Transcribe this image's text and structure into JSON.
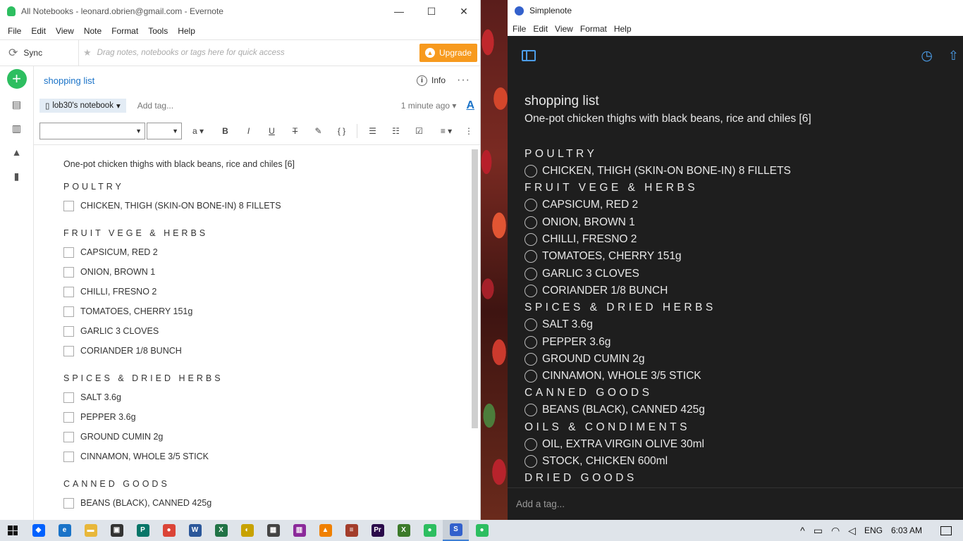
{
  "evernote": {
    "window_title": "All Notebooks - leonard.obrien@gmail.com - Evernote",
    "menu": [
      "File",
      "Edit",
      "View",
      "Note",
      "Format",
      "Tools",
      "Help"
    ],
    "sync_label": "Sync",
    "shortcut_hint": "Drag notes, notebooks or tags here for quick access",
    "upgrade_label": "Upgrade",
    "note_title": "shopping list",
    "info_label": "Info",
    "notebook_label": "lob30's notebook",
    "add_tag_label": "Add tag...",
    "updated_label": "1 minute ago",
    "intro": "One-pot chicken thighs with black beans, rice and chiles [6]",
    "sections": [
      {
        "heading": "POULTRY",
        "items": [
          "CHICKEN, THIGH (SKIN-ON BONE-IN)   8 FILLETS"
        ]
      },
      {
        "heading": "FRUIT VEGE  &  HERBS",
        "items": [
          "CAPSICUM, RED   2",
          "ONION, BROWN   1",
          "CHILLI, FRESNO   2",
          "TOMATOES, CHERRY   151g",
          "GARLIC   3 CLOVES",
          "CORIANDER   1/8 BUNCH"
        ]
      },
      {
        "heading": "SPICES & DRIED HERBS",
        "items": [
          "SALT   3.6g",
          "PEPPER   3.6g",
          "GROUND CUMIN   2g",
          "CINNAMON, WHOLE   3/5 STICK"
        ]
      },
      {
        "heading": "CANNED GOODS",
        "items": [
          "BEANS (BLACK), CANNED   425g"
        ]
      }
    ]
  },
  "simplenote": {
    "window_title": "Simplenote",
    "menu": [
      "File",
      "Edit",
      "View",
      "Format",
      "Help"
    ],
    "note_title": "shopping list",
    "intro": "One-pot chicken thighs with black beans, rice and chiles [6]",
    "sections": [
      {
        "heading": "POULTRY",
        "items": [
          "CHICKEN, THIGH (SKIN-ON BONE-IN)   8 FILLETS"
        ]
      },
      {
        "heading": "FRUIT VEGE  &  HERBS",
        "items": [
          "CAPSICUM, RED   2",
          "ONION, BROWN   1",
          "CHILLI, FRESNO   2",
          "TOMATOES, CHERRY   151g",
          "GARLIC   3 CLOVES",
          "CORIANDER   1/8 BUNCH"
        ]
      },
      {
        "heading": "SPICES & DRIED HERBS",
        "items": [
          "SALT   3.6g",
          "PEPPER   3.6g",
          "GROUND CUMIN   2g",
          "CINNAMON, WHOLE   3/5 STICK"
        ]
      },
      {
        "heading": "CANNED GOODS",
        "items": [
          "BEANS (BLACK), CANNED   425g"
        ]
      },
      {
        "heading": "OILS & CONDIMENTS",
        "items": [
          "OIL, EXTRA VIRGIN OLIVE   30ml",
          "STOCK, CHICKEN   600ml"
        ]
      },
      {
        "heading": "DRIED GOODS",
        "items": []
      }
    ],
    "add_tag_placeholder": "Add a tag..."
  },
  "taskbar": {
    "apps": [
      {
        "name": "dropbox-icon",
        "color": "#0061fe",
        "glyph": "◆"
      },
      {
        "name": "edge-icon",
        "color": "#1a73c8",
        "glyph": "e"
      },
      {
        "name": "file-explorer-icon",
        "color": "#e8b73a",
        "glyph": "▬"
      },
      {
        "name": "store-icon",
        "color": "#333333",
        "glyph": "▣"
      },
      {
        "name": "publisher-icon",
        "color": "#077568",
        "glyph": "P"
      },
      {
        "name": "chrome-icon",
        "color": "#db4437",
        "glyph": "●"
      },
      {
        "name": "word-icon",
        "color": "#2b579a",
        "glyph": "W"
      },
      {
        "name": "excel-icon",
        "color": "#217346",
        "glyph": "X"
      },
      {
        "name": "lightroom-icon",
        "color": "#c8a200",
        "glyph": "◐"
      },
      {
        "name": "calculator-icon",
        "color": "#444444",
        "glyph": "▦"
      },
      {
        "name": "winrar-icon",
        "color": "#8b2a9a",
        "glyph": "▥"
      },
      {
        "name": "vlc-icon",
        "color": "#f08000",
        "glyph": "▲"
      },
      {
        "name": "books-icon",
        "color": "#a33d2b",
        "glyph": "≡"
      },
      {
        "name": "premiere-icon",
        "color": "#2a0a4a",
        "glyph": "Pr"
      },
      {
        "name": "project-icon",
        "color": "#3c7a2a",
        "glyph": "X"
      },
      {
        "name": "evernote-icon",
        "color": "#2dbe60",
        "glyph": "●"
      },
      {
        "name": "simplenote-icon",
        "color": "#3361cc",
        "glyph": "S"
      },
      {
        "name": "evernote-2-icon",
        "color": "#2dbe60",
        "glyph": "●"
      }
    ],
    "lang": "ENG",
    "time": "6:03 AM"
  }
}
